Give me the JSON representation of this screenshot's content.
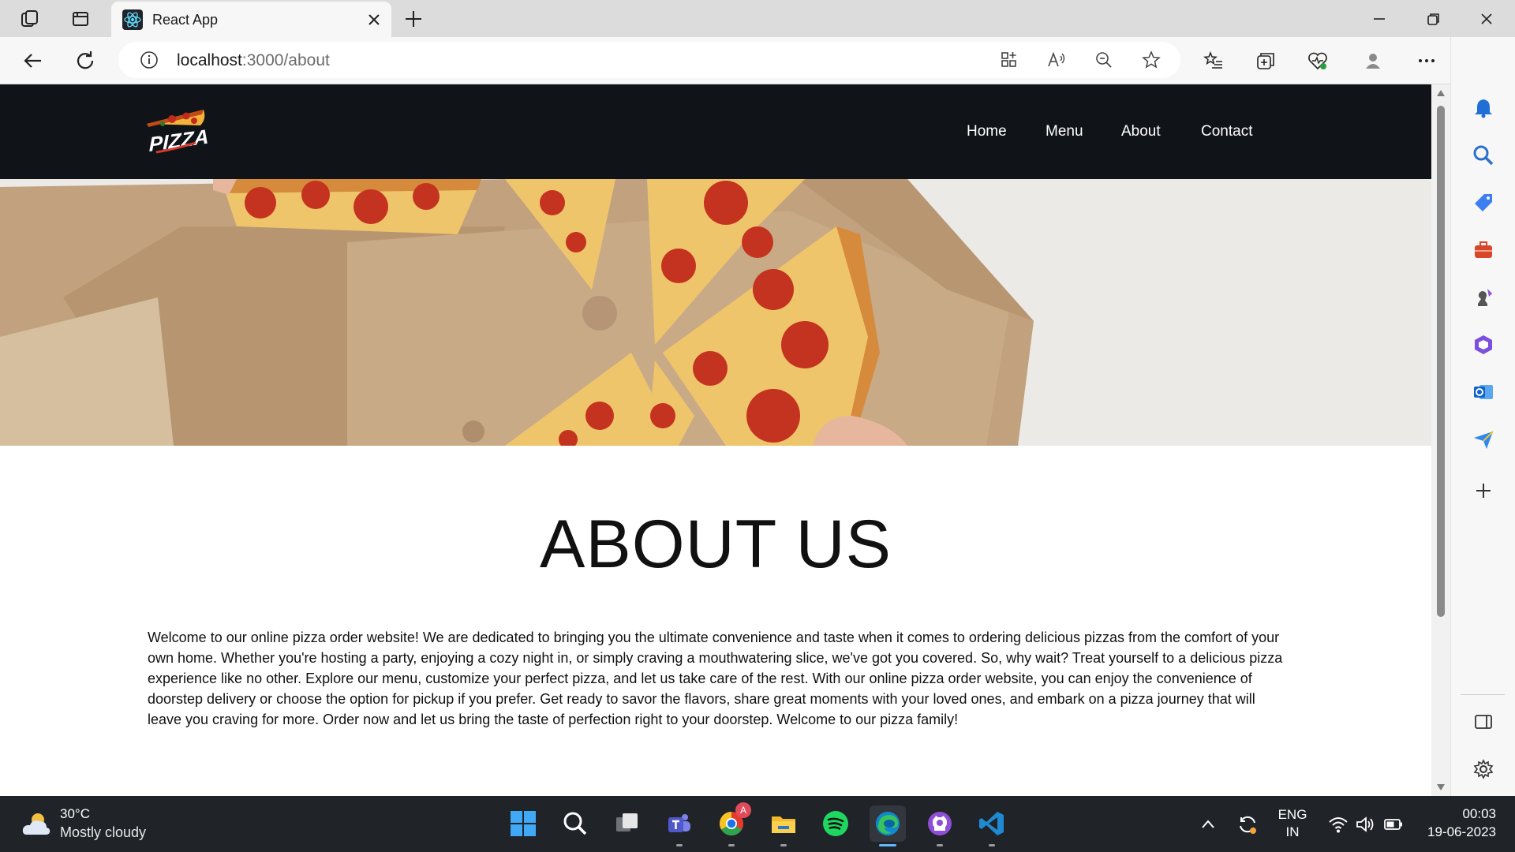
{
  "browser": {
    "tab_title": "React App",
    "url_host": "localhost",
    "url_path": ":3000/about"
  },
  "site": {
    "logo_text": "PIZZA",
    "nav": [
      {
        "label": "Home"
      },
      {
        "label": "Menu"
      },
      {
        "label": "About"
      },
      {
        "label": "Contact"
      }
    ],
    "heading": "ABOUT US",
    "body": "Welcome to our online pizza order website! We are dedicated to bringing you the ultimate convenience and taste when it comes to ordering delicious pizzas from the comfort of your own home. Whether you're hosting a party, enjoying a cozy night in, or simply craving a mouthwatering slice, we've got you covered. So, why wait? Treat yourself to a delicious pizza experience like no other. Explore our menu, customize your perfect pizza, and let us take care of the rest. With our online pizza order website, you can enjoy the convenience of doorstep delivery or choose the option for pickup if you prefer. Get ready to savor the flavors, share great moments with your loved ones, and embark on a pizza journey that will leave you craving for more. Order now and let us bring the taste of perfection right to your doorstep. Welcome to our pizza family!"
  },
  "taskbar": {
    "weather_temp": "30°C",
    "weather_desc": "Mostly cloudy",
    "chrome_badge": "A",
    "lang_line1": "ENG",
    "lang_line2": "IN",
    "time": "00:03",
    "date": "19-06-2023"
  },
  "colors": {
    "site_nav_bg": "#101318",
    "taskbar_bg": "#202328",
    "edge_accent": "#0078d4"
  }
}
